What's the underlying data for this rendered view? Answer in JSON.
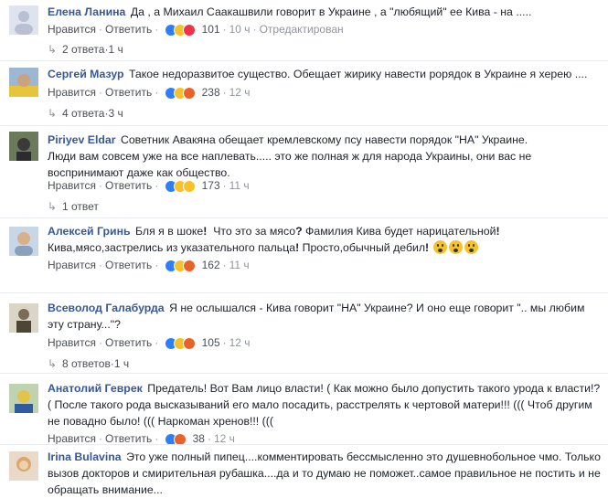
{
  "common": {
    "like": "Нравится",
    "reply": "Ответить",
    "dot": "·"
  },
  "comments": [
    {
      "author": "Елена Ланина",
      "text": "Да , а Михаил Саакашвили говорит в Украине , а \"любящий\" ее Кива - на .....",
      "reactions": "101",
      "time": "10 ч",
      "edited": "Отредактирован",
      "replies": "2 ответа",
      "reply_time": "1 ч"
    },
    {
      "author": "Сергей Мазур",
      "text": "Такое недоразвитое существо. Обещает жирику навести рорядок в Украине я херею ....",
      "reactions": "238",
      "time": "12 ч",
      "replies": "4 ответа",
      "reply_time": "3 ч"
    },
    {
      "author": "Piriyev Eldar",
      "text": "Советник Авакяна обещает кремлевскому псу навести порядок \"НА\" Украине.",
      "text2": "Люди вам совсем уже на все наплевать..... это же полная ж для народа Украины, они вас не воспринимают даже как общество.",
      "reactions": "173",
      "time": "11 ч",
      "replies": "1 ответ"
    },
    {
      "author": "Алексей Гринь",
      "text_a": "Бля я в шоке",
      "text_b": "Что это за мясо",
      "text_c": "Фамилия Кива будет нарицательной",
      "text_d": "Кива,мясо,застрелись из указательного пальца",
      "text_e": "Просто,обычный дебил",
      "excl": "!",
      "q": "?",
      "reactions": "162",
      "time": "11 ч"
    },
    {
      "author": "Всеволод Галабурда",
      "text": "Я не ослышался - Кива говорит \"НА\" Украине? И оно еще говорит \".. мы любим эту страну...\"?",
      "reactions": "105",
      "time": "12 ч",
      "replies": "8 ответов",
      "reply_time": "1 ч"
    },
    {
      "author": "Анатолий Геврек",
      "text": "Предатель! Вот Вам лицо власти! ( Как можно было допустить такого урода к власти!? ( После такого рода высказываний его мало посадить, расстрелять к чертовой матери!!! ((( Чтоб другим не повадно было! ((( Наркоман хренов!!! (((",
      "reactions": "38",
      "time": "12 ч"
    },
    {
      "author": "Irina Bulavina",
      "text": "Это уже полный пипец....комментировать бессмысленно это душевнобольное чмо. Только вызов докторов и смирительная рубашка....да и то думаю не поможет..самое правильное не постить и не обращать внимание..."
    }
  ],
  "colors": {
    "author": "#365899",
    "like": "#2d7ff9",
    "haha": "#f7c229",
    "angry": "#e96328",
    "love": "#f0334b"
  }
}
